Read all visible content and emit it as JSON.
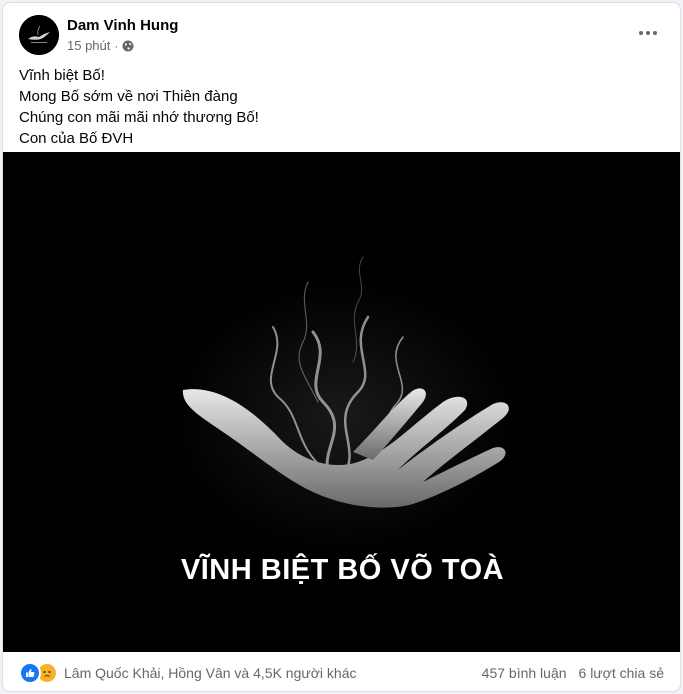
{
  "post": {
    "author": "Dam Vinh Hung",
    "time": "15 phút",
    "separator": "·",
    "privacy_icon": "globe-icon",
    "more_icon": "more-horizontal-icon",
    "text_lines": [
      "Vĩnh biệt Bố!",
      "Mong Bố sớm về nơi Thiên đàng",
      "Chúng con mãi mãi nhớ thương Bố!",
      "Con của Bố ĐVH"
    ],
    "image_caption": "VĨNH BIỆT BỐ VÕ TOÀ"
  },
  "footer": {
    "reaction_icons": [
      "like-icon",
      "sad-icon"
    ],
    "reactors": "Lâm Quốc Khải, Hồng Vân và 4,5K người khác",
    "comments": "457 bình luận",
    "shares": "6 lượt chia sẻ"
  },
  "colors": {
    "like": "#1877f2",
    "sad": "#f7b125",
    "secondary_text": "#65676b",
    "primary_text": "#050505"
  }
}
